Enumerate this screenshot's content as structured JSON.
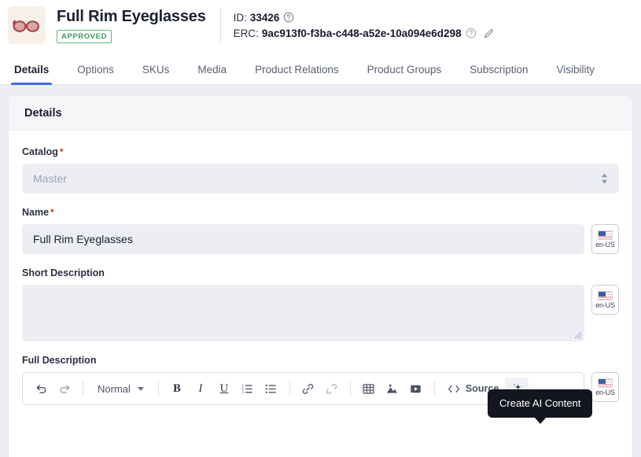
{
  "header": {
    "thumbnail_alt": "eyeglasses-thumbnail",
    "product_title": "Full Rim Eyeglasses",
    "status_badge": "APPROVED",
    "status_color": "#3a9a5c",
    "id_label": "ID:",
    "id_value": "33426",
    "erc_label": "ERC:",
    "erc_value": "9ac913f0-f3ba-c448-a52e-10a094e6d298"
  },
  "tabs": [
    {
      "label": "Details",
      "active": true
    },
    {
      "label": "Options",
      "active": false
    },
    {
      "label": "SKUs",
      "active": false
    },
    {
      "label": "Media",
      "active": false
    },
    {
      "label": "Product Relations",
      "active": false
    },
    {
      "label": "Product Groups",
      "active": false
    },
    {
      "label": "Subscription",
      "active": false
    },
    {
      "label": "Visibility",
      "active": false
    }
  ],
  "accent_color": "#3c6fe5",
  "card": {
    "title": "Details"
  },
  "form": {
    "catalog": {
      "label": "Catalog",
      "required": true,
      "value": "Master",
      "disabled": true
    },
    "name": {
      "label": "Name",
      "required": true,
      "value": "Full Rim Eyeglasses",
      "lang": "en-US"
    },
    "short_description": {
      "label": "Short Description",
      "required": false,
      "value": "",
      "lang": "en-US"
    },
    "full_description": {
      "label": "Full Description",
      "required": false,
      "lang": "en-US"
    }
  },
  "editor_toolbar": {
    "undo": "undo-icon",
    "redo": "redo-icon",
    "format_dropdown": "Normal",
    "bold": "B",
    "italic": "I",
    "underline": "U",
    "ordered_list": "ordered-list-icon",
    "bullet_list": "bullet-list-icon",
    "link": "link-icon",
    "unlink": "unlink-icon",
    "table": "table-icon",
    "image": "image-icon",
    "video": "video-icon",
    "source_label": "Source",
    "ai_button": "sparkle-ai-icon"
  },
  "tooltip": {
    "text": "Create AI Content"
  }
}
